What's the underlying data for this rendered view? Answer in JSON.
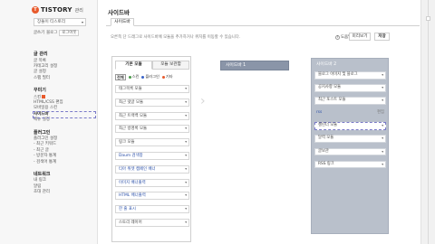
{
  "brand": {
    "logo_letter": "T",
    "name": "TISTORY",
    "sub": "관리"
  },
  "blog_select": {
    "value": "장돌이 티스토리",
    "caret": "▾"
  },
  "top_links": [
    "글쓰기",
    "블로그",
    "로그아웃"
  ],
  "nav": [
    {
      "head": "글 관리",
      "items": [
        "글 목록",
        "카테고리 설정",
        "글 설정",
        "스팸 필터"
      ]
    },
    {
      "head": "꾸미기",
      "items": [
        "스킨",
        "HTML/CSS 편집",
        "모바일용 스킨",
        "사이드바",
        "메뉴 설정"
      ]
    },
    {
      "head": "플러그인",
      "items": [
        "플러그인 설정",
        "- 최근 키워드",
        "- 최근 글",
        "- 방문자 통계",
        "- 검색어 통계"
      ]
    },
    {
      "head": "네트워크",
      "items": [
        "내 링크",
        "알림",
        "초대 관리"
      ]
    }
  ],
  "page": {
    "title": "사이드바",
    "tab": "사이드바",
    "description": "오른쪽 단 드래그로 사이드바에 모듈을 추가하거나 위치를 이동할 수 있습니다.",
    "help_label": "도움말",
    "help_icon": "?",
    "prev_button": "미리보기",
    "save_button": "저장"
  },
  "module_panel": {
    "tabs": [
      "기본 모듈",
      "모듈 보관함"
    ],
    "filter": {
      "all": "전체",
      "items": [
        {
          "label": "스킨",
          "color": "#4a9a4a"
        },
        {
          "label": "플러그인",
          "color": "#3a63c8"
        },
        {
          "label": "기타",
          "color": "#e85a2c"
        }
      ]
    },
    "items": [
      {
        "label": "태그목록 모듈",
        "blue": false
      },
      {
        "label": "최근 댓글 모듈",
        "blue": false
      },
      {
        "label": "최근 트랙백 모듈",
        "blue": false
      },
      {
        "label": "최근 방명록 모듈",
        "blue": false
      },
      {
        "label": "링크 모듈",
        "blue": false
      },
      {
        "label": "Daum 검색창",
        "blue": true
      },
      {
        "label": "티아 위젯 캠페인 배너",
        "blue": true
      },
      {
        "label": "이미지 배너출력",
        "blue": true
      },
      {
        "label": "HTML 배너출력",
        "blue": true
      },
      {
        "label": "한 줄 표시",
        "blue": true
      },
      {
        "label": "스토리 레이어",
        "blue": false
      }
    ]
  },
  "sidebar1": {
    "label": "사이드바 1"
  },
  "sidebar2": {
    "label": "사이드바 2",
    "items": [
      {
        "label": "블로그 이미지 및 블로그",
        "type": "box"
      },
      {
        "label": "공지사항 모듈",
        "type": "box"
      },
      {
        "label": "최근 포스트 모듈",
        "type": "box"
      },
      {
        "label": "rss",
        "type": "text",
        "right": "편집"
      },
      {
        "label": "캘린더 모듈",
        "type": "dashed"
      },
      {
        "label": "달력 모듈",
        "type": "box"
      },
      {
        "label": "글보관",
        "type": "box"
      },
      {
        "label": "RSS 링크",
        "type": "box"
      }
    ]
  },
  "icons": {
    "dropdown": "▾",
    "next": "›"
  }
}
